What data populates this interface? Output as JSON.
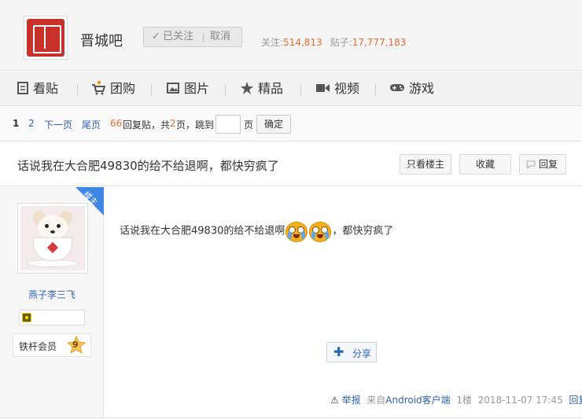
{
  "header": {
    "forum_name": "晋城吧",
    "follow": {
      "check": "✓",
      "followed_label": "已关注",
      "cancel_label": "取消"
    },
    "stats": {
      "follow_label": "关注:",
      "follow_count": "514,813",
      "posts_label": "贴子:",
      "posts_count": "17,777,183"
    }
  },
  "nav": {
    "items": [
      {
        "label": "看贴",
        "icon": "document-icon"
      },
      {
        "label": "团购",
        "icon": "shopping-cart-icon"
      },
      {
        "label": "图片",
        "icon": "image-icon"
      },
      {
        "label": "精品",
        "icon": "star-icon"
      },
      {
        "label": "视频",
        "icon": "video-icon"
      },
      {
        "label": "游戏",
        "icon": "gamepad-icon"
      }
    ]
  },
  "pager": {
    "current": "1",
    "page2": "2",
    "next": "下一页",
    "last": "尾页",
    "reply_count": "66",
    "reply_text": "回复贴，共",
    "page_total": "2",
    "page_suffix": "页，跳到",
    "page_unit": "页",
    "ok": "确定"
  },
  "thread": {
    "title": "话说我在大合肥49830的给不给退啊，都快穷疯了",
    "btn_owner_only": "只看楼主",
    "btn_favorite": "收藏",
    "btn_reply": "回复"
  },
  "post": {
    "louzhu_tag": "楼主",
    "username": "燕子李三飞",
    "level_name": "铁杆会员",
    "level_num": "9",
    "content_before": "话说我在大合肥49830的给不给退啊",
    "content_after": "，都快穷疯了",
    "share": "分享",
    "report": "举报",
    "source_prefix": "来自",
    "source": "Android客户端",
    "floor": "1楼",
    "time": "2018-11-07 17:45",
    "reply": "回复"
  },
  "colors": {
    "accent_orange": "#e86c33",
    "link_blue": "#2d64b3",
    "louzhu_blue": "#3e87e5",
    "logo_red": "#c8302a"
  }
}
